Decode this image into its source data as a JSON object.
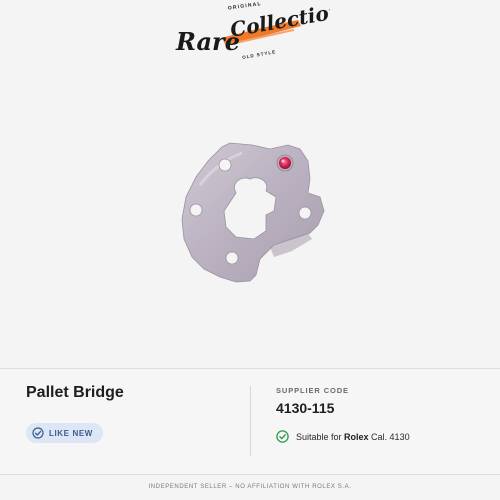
{
  "logo": {
    "top_text": "ORIGINAL",
    "script_left": "Rare",
    "script_right": "Collections",
    "bottom_text": "OLD STYLE",
    "accent_color": "#f07a2a"
  },
  "product": {
    "image_alt": "pallet-bridge-part",
    "name": "Pallet Bridge",
    "condition": "LIKE NEW",
    "condition_icon": "check-circle-icon"
  },
  "supplier": {
    "label": "SUPPLIER CODE",
    "code": "4130-115",
    "compat_prefix": "Suitable for ",
    "compat_brand": "Rolex",
    "compat_suffix": " Cal. 4130",
    "compat_icon": "check-circle-icon",
    "compat_color": "#2e9a48"
  },
  "footer": {
    "disclaimer": "INDEPENDENT SELLER – NO AFFILIATION WITH ROLEX S.A."
  }
}
